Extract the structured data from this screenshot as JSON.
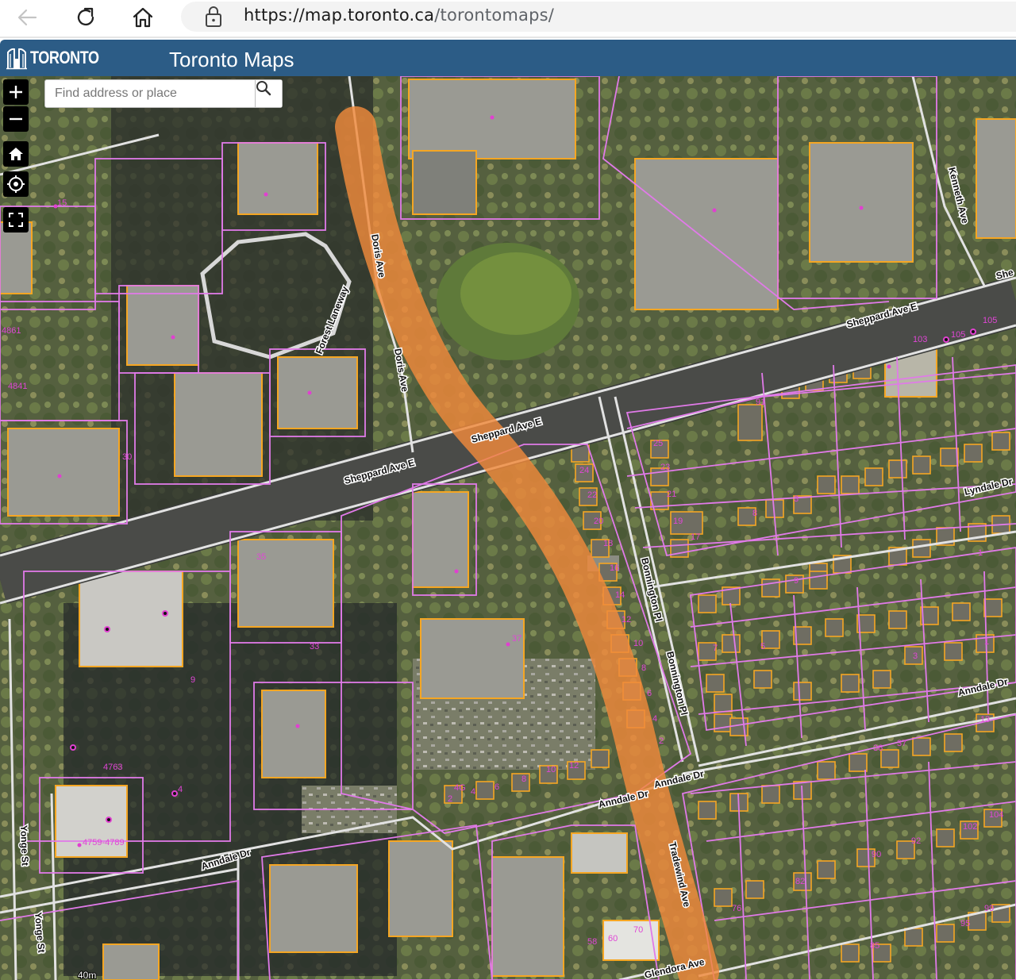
{
  "browser": {
    "url_host": "https://map.toronto.ca",
    "url_path": "/torontomaps/"
  },
  "header": {
    "logo_text": "TORONTO",
    "title": "Toronto Maps"
  },
  "search": {
    "placeholder": "Find address or place"
  },
  "map": {
    "controls": [
      "zoom-in",
      "zoom-out",
      "home",
      "locate",
      "fullscreen"
    ],
    "street_labels": [
      "Doris Ave",
      "Doris Ave",
      "Forest Laneway",
      "Sheppard Ave E",
      "Sheppard Ave E",
      "Sheppard Ave E",
      "Kenneth Ave",
      "Lyndale Dr",
      "Bonnington Pl",
      "Bonnington Pl",
      "Anndale Dr",
      "Anndale Dr",
      "Anndale Dr",
      "Anndale Dr",
      "Tradewind Ave",
      "Glendora Ave",
      "Yonge St",
      "Yonge St",
      "She"
    ],
    "address_labels": [
      "15",
      "4861",
      "4841",
      "30",
      "35",
      "33",
      "37",
      "9",
      "4763",
      "4",
      "4759-4789",
      "2",
      "4G",
      "4",
      "6",
      "8",
      "10",
      "12",
      "24",
      "22",
      "20",
      "18",
      "16",
      "14",
      "12",
      "10",
      "8",
      "6",
      "4",
      "2",
      "25",
      "23",
      "21",
      "19",
      "17",
      "91",
      "103",
      "105",
      "105",
      "9",
      "7",
      "5",
      "3",
      "1",
      "58",
      "60",
      "70",
      "92",
      "90",
      "82",
      "76",
      "85",
      "99",
      "95",
      "104",
      "102",
      "37",
      "36",
      "13",
      "1",
      "8",
      "3"
    ],
    "scale_label": "40m",
    "colors": {
      "property_line": "#e07ae8",
      "building_outline": "#f5a623",
      "highlight_route": "#f08a3c",
      "road": "#dcdcdc"
    }
  }
}
